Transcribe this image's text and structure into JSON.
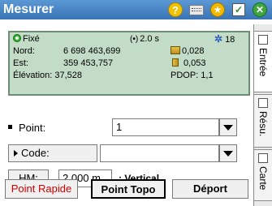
{
  "window": {
    "title": "Mesurer"
  },
  "status": {
    "fix_label": "Fixé",
    "latency": "2.0 s",
    "satellites": "18",
    "nord_label": "Nord:",
    "nord_value": "6 698 463,699",
    "est_label": "Est:",
    "est_value": "359 453,757",
    "elevation_label": "Élévation:",
    "elevation_value": "37,528",
    "h_precision": "0,028",
    "v_precision": "0,053",
    "pdop_label": "PDOP:",
    "pdop_value": "1,1"
  },
  "form": {
    "point_label": "Point:",
    "point_value": "1",
    "code_label": "Code:",
    "code_value": "",
    "hm_label": "HM:",
    "hm_value": "2,000 m",
    "hm_mode": ": Vertical"
  },
  "buttons": {
    "rapid": "Point Rapide",
    "topo": "Point Topo",
    "offset": "Déport"
  },
  "tabs": [
    {
      "label": "Entrée"
    },
    {
      "label": "Résu."
    },
    {
      "label": "Carte"
    }
  ],
  "colors": {
    "titlebar": "#3a74b6",
    "status_panel": "#c3dcc7",
    "rapid_text": "#d00000"
  }
}
